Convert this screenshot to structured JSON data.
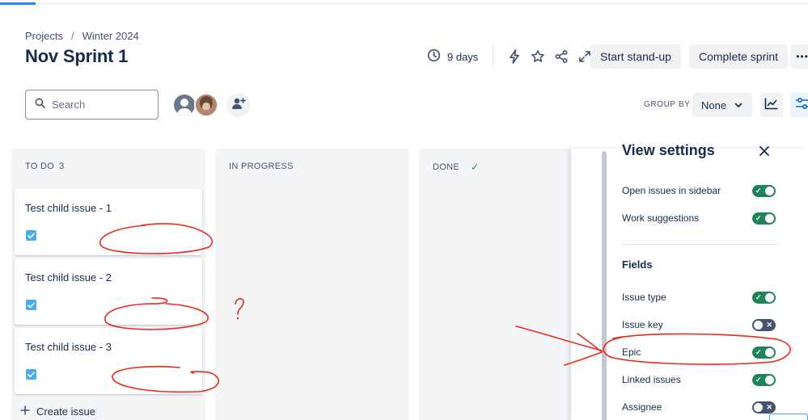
{
  "breadcrumb": {
    "projects": "Projects",
    "separator": "/",
    "current": "Winter 2024"
  },
  "page_title": "Nov Sprint 1",
  "header": {
    "days_remaining": "9 days",
    "start_standup": "Start stand-up",
    "complete_sprint": "Complete sprint",
    "more": "•••"
  },
  "search": {
    "placeholder": "Search",
    "value": ""
  },
  "toolbar": {
    "group_by_label": "GROUP BY",
    "group_by_value": "None"
  },
  "columns": [
    {
      "name": "TO DO",
      "count": "3"
    },
    {
      "name": "IN PROGRESS"
    },
    {
      "name": "DONE",
      "done_mark": "✓"
    }
  ],
  "cards": [
    {
      "title": "Test child issue - 1",
      "type": "task-icon"
    },
    {
      "title": "Test child issue - 2",
      "type": "task-icon"
    },
    {
      "title": "Test child issue - 3",
      "type": "task-icon"
    }
  ],
  "create_issue": "Create issue",
  "view_settings": {
    "title": "View settings",
    "general": [
      {
        "label": "Open issues in sidebar",
        "enabled": true
      },
      {
        "label": "Work suggestions",
        "enabled": true
      }
    ],
    "fields_heading": "Fields",
    "fields": [
      {
        "label": "Issue type",
        "enabled": true
      },
      {
        "label": "Issue key",
        "enabled": false
      },
      {
        "label": "Epic",
        "enabled": true
      },
      {
        "label": "Linked issues",
        "enabled": true
      },
      {
        "label": "Assignee",
        "enabled": false
      }
    ]
  },
  "annotation": {
    "question_mark": "?"
  },
  "colors": {
    "toggle_on": "#1f845a",
    "toggle_off": "#44546f",
    "task_icon": "#4bade8",
    "annotation_red": "#e8291c",
    "accent": "#2684ff"
  }
}
